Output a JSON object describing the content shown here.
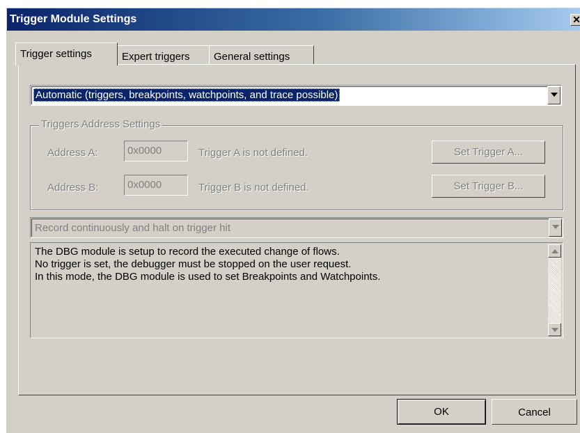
{
  "window": {
    "title": "Trigger Module Settings",
    "close_glyph": "✕"
  },
  "tabs": [
    {
      "label": "Trigger settings",
      "active": true
    },
    {
      "label": "Expert triggers",
      "active": false
    },
    {
      "label": "General settings",
      "active": false
    }
  ],
  "mode_select": {
    "value": "Automatic (triggers, breakpoints, watchpoints, and trace possible)"
  },
  "address_group": {
    "legend": "Triggers Address Settings",
    "a": {
      "label": "Address A:",
      "value": "0x0000",
      "status": "Trigger A is not defined.",
      "button": "Set Trigger A..."
    },
    "b": {
      "label": "Address B:",
      "value": "0x0000",
      "status": "Trigger B is not defined.",
      "button": "Set Trigger B..."
    }
  },
  "record_select": {
    "value": "Record continuously and halt on trigger hit"
  },
  "description": {
    "lines": [
      "The DBG module is setup to record the executed change of flows.",
      "No trigger is set, the debugger must be stopped on the user request.",
      "In this mode, the DBG module is used to set Breakpoints and Watchpoints."
    ]
  },
  "buttons": {
    "ok": "OK",
    "cancel": "Cancel"
  },
  "colors": {
    "face": "#d4d0c8",
    "title_start": "#0a246a",
    "title_end": "#a6caf0",
    "disabled_text": "#808080"
  },
  "icons": {
    "close": "close-icon",
    "dropdown": "chevron-down-icon",
    "scroll_up": "scroll-up-icon",
    "scroll_down": "scroll-down-icon"
  }
}
